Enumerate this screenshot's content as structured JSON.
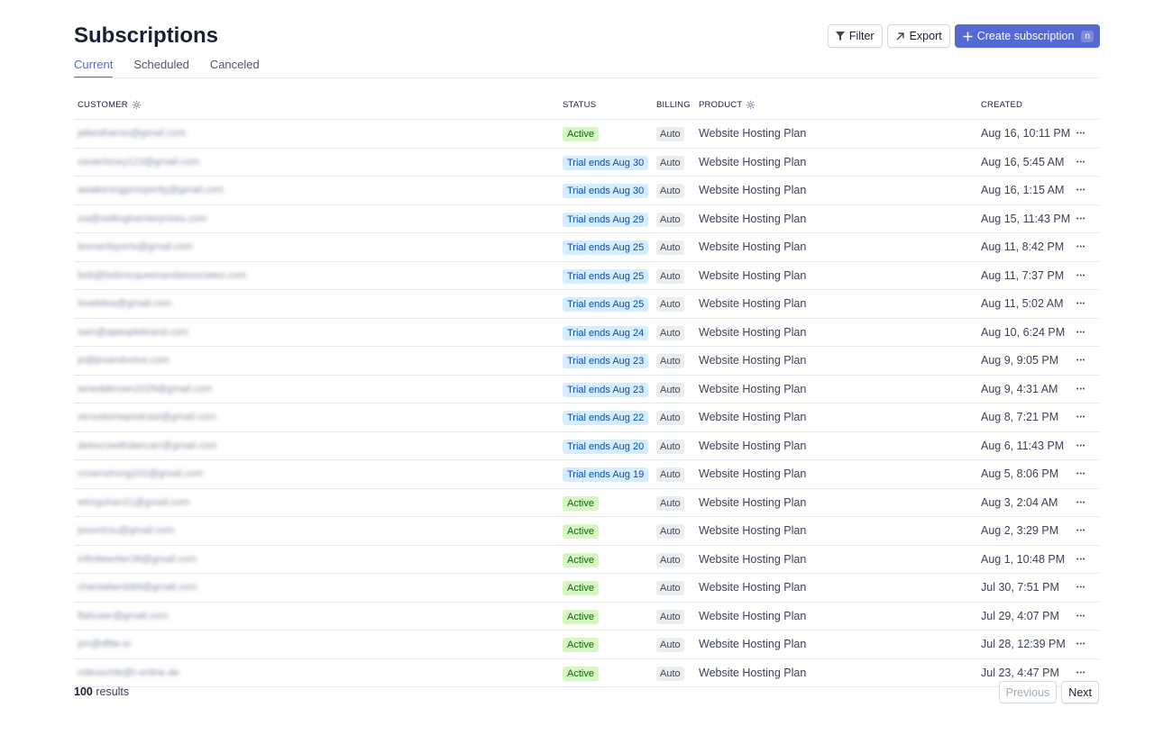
{
  "page": {
    "title": "Subscriptions"
  },
  "tabs": [
    {
      "label": "Current",
      "active": true
    },
    {
      "label": "Scheduled",
      "active": false
    },
    {
      "label": "Canceled",
      "active": false
    }
  ],
  "toolbar": {
    "filter_label": "Filter",
    "export_label": "Export",
    "create_label": "Create subscription",
    "create_shortcut": "n"
  },
  "columns": {
    "customer": "CUSTOMER",
    "status": "STATUS",
    "billing": "BILLING",
    "product": "PRODUCT",
    "created": "CREATED"
  },
  "colors": {
    "accent": "#5469d4",
    "active_badge_bg": "#d7f7c2",
    "active_badge_text": "#05690d",
    "trial_badge_bg": "#d6ecff",
    "trial_badge_text": "#0a4fa8"
  },
  "rows": [
    {
      "customer": "jallenthamio@gmail.com",
      "status": "Active",
      "status_kind": "active",
      "billing": "Auto",
      "product": "Website Hosting Plan",
      "created": "Aug 16, 10:11 PM"
    },
    {
      "customer": "xavierloney123@gmail.com",
      "status": "Trial ends Aug 30",
      "status_kind": "trial",
      "billing": "Auto",
      "product": "Website Hosting Plan",
      "created": "Aug 16, 5:45 AM"
    },
    {
      "customer": "awakeningprosperity@gmail.com",
      "status": "Trial ends Aug 30",
      "status_kind": "trial",
      "billing": "Auto",
      "product": "Website Hosting Plan",
      "created": "Aug 16, 1:15 AM"
    },
    {
      "customer": "zia@sellingtoenterprises.com",
      "status": "Trial ends Aug 29",
      "status_kind": "trial",
      "billing": "Auto",
      "product": "Website Hosting Plan",
      "created": "Aug 15, 11:43 PM"
    },
    {
      "customer": "leonardsports@gmail.com",
      "status": "Trial ends Aug 25",
      "status_kind": "trial",
      "billing": "Auto",
      "product": "Website Hosting Plan",
      "created": "Aug 11, 8:42 PM"
    },
    {
      "customer": "bob@bobmcqueenandassociates.com",
      "status": "Trial ends Aug 25",
      "status_kind": "trial",
      "billing": "Auto",
      "product": "Website Hosting Plan",
      "created": "Aug 11, 7:37 PM"
    },
    {
      "customer": "lovebitsa@gmail.com",
      "status": "Trial ends Aug 25",
      "status_kind": "trial",
      "billing": "Auto",
      "product": "Website Hosting Plan",
      "created": "Aug 11, 5:02 AM"
    },
    {
      "customer": "sam@apeoplebrand.com",
      "status": "Trial ends Aug 24",
      "status_kind": "trial",
      "billing": "Auto",
      "product": "Website Hosting Plan",
      "created": "Aug 10, 6:24 PM"
    },
    {
      "customer": "jo@josandvoice.com",
      "status": "Trial ends Aug 23",
      "status_kind": "trial",
      "billing": "Auto",
      "product": "Website Hosting Plan",
      "created": "Aug 9, 9:05 PM"
    },
    {
      "customer": "tanedabrown2029@gmail.com",
      "status": "Trial ends Aug 23",
      "status_kind": "trial",
      "billing": "Auto",
      "product": "Website Hosting Plan",
      "created": "Aug 9, 4:31 AM"
    },
    {
      "customer": "venustomepodcast@gmail.com",
      "status": "Trial ends Aug 22",
      "status_kind": "trial",
      "billing": "Auto",
      "product": "Website Hosting Plan",
      "created": "Aug 8, 7:21 PM"
    },
    {
      "customer": "detourswithdancarr@gmail.com",
      "status": "Trial ends Aug 20",
      "status_kind": "trial",
      "billing": "Auto",
      "product": "Website Hosting Plan",
      "created": "Aug 6, 11:43 PM"
    },
    {
      "customer": "crownstrong202@gmail.com",
      "status": "Trial ends Aug 19",
      "status_kind": "trial",
      "billing": "Auto",
      "product": "Website Hosting Plan",
      "created": "Aug 5, 8:06 PM"
    },
    {
      "customer": "wtmgohan21@gmail.com",
      "status": "Active",
      "status_kind": "active",
      "billing": "Auto",
      "product": "Website Hosting Plan",
      "created": "Aug 3, 2:04 AM"
    },
    {
      "customer": "jooontrou@gmail.com",
      "status": "Active",
      "status_kind": "active",
      "billing": "Auto",
      "product": "Website Hosting Plan",
      "created": "Aug 2, 3:29 PM"
    },
    {
      "customer": "infinitewriter38@gmail.com",
      "status": "Active",
      "status_kind": "active",
      "billing": "Auto",
      "product": "Website Hosting Plan",
      "created": "Aug 1, 10:48 PM"
    },
    {
      "customer": "chantallamb69@gmail.com",
      "status": "Active",
      "status_kind": "active",
      "billing": "Auto",
      "product": "Website Hosting Plan",
      "created": "Jul 30, 7:51 PM"
    },
    {
      "customer": "flahuser@gmail.com",
      "status": "Active",
      "status_kind": "active",
      "billing": "Auto",
      "product": "Website Hosting Plan",
      "created": "Jul 29, 4:07 PM"
    },
    {
      "customer": "jon@dftte.io",
      "status": "Active",
      "status_kind": "active",
      "billing": "Auto",
      "product": "Website Hosting Plan",
      "created": "Jul 28, 12:39 PM"
    },
    {
      "customer": "ndeuschle@t-online.de",
      "status": "Active",
      "status_kind": "active",
      "billing": "Auto",
      "product": "Website Hosting Plan",
      "created": "Jul 23, 4:47 PM"
    }
  ],
  "footer": {
    "count": "100",
    "count_suffix": "results",
    "previous_label": "Previous",
    "next_label": "Next"
  }
}
